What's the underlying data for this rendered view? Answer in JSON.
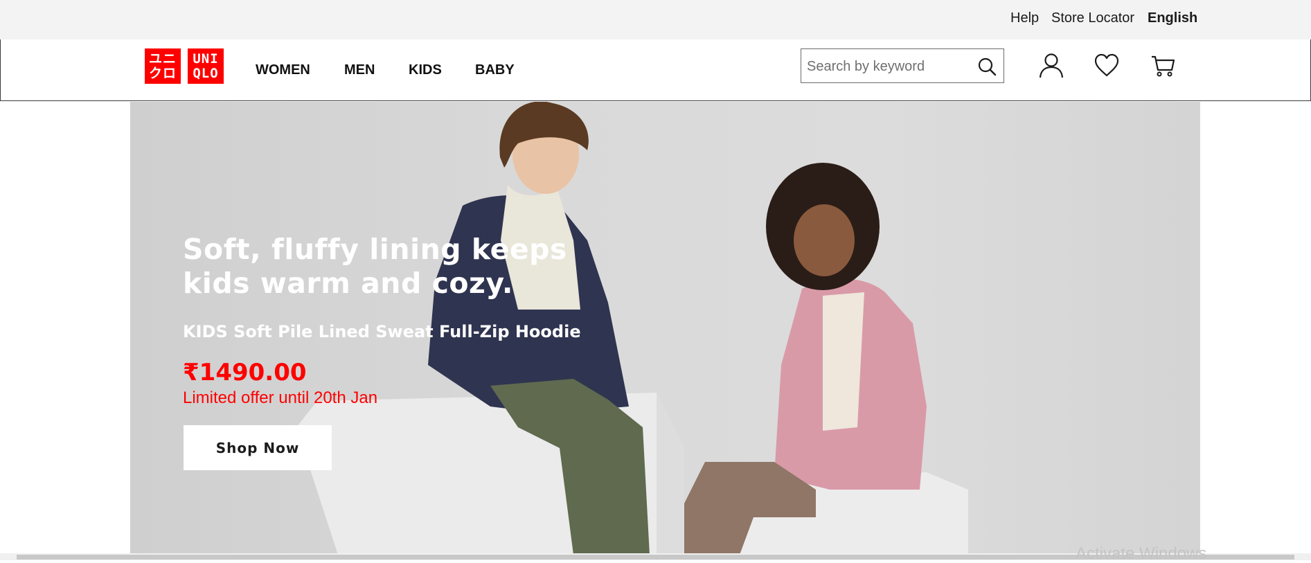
{
  "utility": {
    "help": "Help",
    "store_locator": "Store Locator",
    "language": "English"
  },
  "brand": {
    "logo_left_top": "ユニ",
    "logo_left_bottom": "クロ",
    "logo_right_top": "UNI",
    "logo_right_bottom": "QLO",
    "color": "#ff0000"
  },
  "nav": {
    "items": [
      {
        "label": "WOMEN"
      },
      {
        "label": "MEN"
      },
      {
        "label": "KIDS"
      },
      {
        "label": "BABY"
      }
    ]
  },
  "search": {
    "placeholder": "Search by keyword",
    "value": "",
    "icon": "search-icon"
  },
  "header_icons": [
    "account-icon",
    "wishlist-heart-icon",
    "cart-icon"
  ],
  "hero": {
    "headline": "Soft, fluffy lining keeps kids warm and cozy.",
    "product_name": "KIDS Soft Pile Lined Sweat Full-Zip Hoodie",
    "price": "₹1490.00",
    "offer": "Limited offer until 20th Jan",
    "cta_label": "Shop Now",
    "price_color": "#ff0000"
  },
  "os_watermark": "Activate Windows"
}
